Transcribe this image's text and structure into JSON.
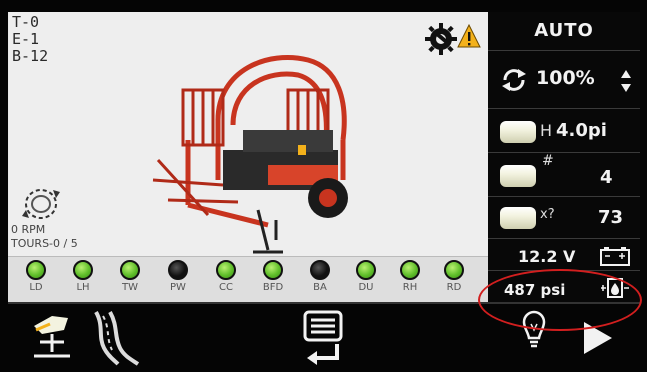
{
  "counters": {
    "t": "T-0",
    "e": "E-1",
    "b": "B-12"
  },
  "status": {
    "rpm": "0 RPM",
    "tours": "TOURS-0 / 5"
  },
  "indicators": [
    {
      "label": "LD",
      "state": "on"
    },
    {
      "label": "LH",
      "state": "on"
    },
    {
      "label": "TW",
      "state": "on"
    },
    {
      "label": "PW",
      "state": "off"
    },
    {
      "label": "CC",
      "state": "on"
    },
    {
      "label": "BFD",
      "state": "on"
    },
    {
      "label": "BA",
      "state": "off"
    },
    {
      "label": "DU",
      "state": "on"
    },
    {
      "label": "RH",
      "state": "on"
    },
    {
      "label": "RD",
      "state": "on"
    }
  ],
  "panel": {
    "mode": "AUTO",
    "speed": "100%",
    "bale_height": {
      "symbol": "H",
      "value": "4.0pi"
    },
    "bale_count": {
      "symbol": "#",
      "value": "4"
    },
    "bale_target": {
      "symbol": "x?",
      "value": "73"
    },
    "voltage": "12.2 V",
    "pressure": "487 psi"
  },
  "icons": {
    "settings": "gear-wrench-icon",
    "warning": "warning-triangle-icon",
    "rotation": "rotation-counter-icon",
    "speed": "rotate-arrows-icon",
    "battery": "battery-icon",
    "oil": "oil-pressure-icon",
    "lift": "lift-arm-icon",
    "road": "road-mode-icon",
    "menu": "menu-return-icon",
    "light": "work-light-icon",
    "next": "play-next-icon"
  },
  "colors": {
    "lamp_on": "#5fbe2a",
    "lamp_off": "#111111",
    "highlight": "#d21f1f",
    "machine": "#c8341f",
    "warning": "#f3b11b"
  }
}
